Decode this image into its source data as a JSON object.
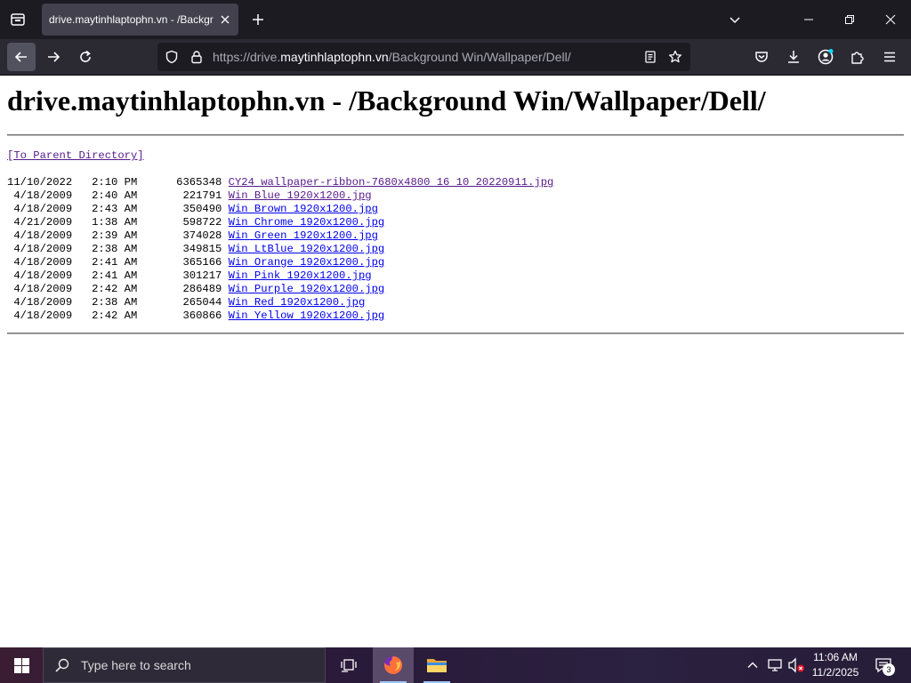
{
  "browser": {
    "tab": {
      "title": "drive.maytinhlaptophn.vn - /Background Win/Wallpaper/Dell/"
    },
    "url": {
      "scheme": "https://drive.",
      "host": "maytinhlaptophn.vn",
      "path": "/Background Win/Wallpaper/Dell/"
    },
    "colors": {
      "tabbar": "#1c1b22",
      "navbar": "#2b2a33",
      "urlbar": "#1c1b22"
    }
  },
  "page": {
    "heading": "drive.maytinhlaptophn.vn - /Background Win/Wallpaper/Dell/",
    "parent_link": "[To Parent Directory]",
    "files": [
      {
        "date": "11/10/2022",
        "time": "2:10 PM",
        "size": "6365348",
        "name": "CY24 wallpaper-ribbon-7680x4800 16 10 20220911.jpg",
        "visited": true
      },
      {
        "date": "4/18/2009",
        "time": "2:40 AM",
        "size": "221791",
        "name": "Win Blue 1920x1200.jpg",
        "visited": true
      },
      {
        "date": "4/18/2009",
        "time": "2:43 AM",
        "size": "350490",
        "name": "Win Brown 1920x1200.jpg",
        "visited": false
      },
      {
        "date": "4/21/2009",
        "time": "1:38 AM",
        "size": "598722",
        "name": "Win Chrome 1920x1200.jpg",
        "visited": false
      },
      {
        "date": "4/18/2009",
        "time": "2:39 AM",
        "size": "374028",
        "name": "Win Green 1920x1200.jpg",
        "visited": false
      },
      {
        "date": "4/18/2009",
        "time": "2:38 AM",
        "size": "349815",
        "name": "Win LtBlue 1920x1200.jpg",
        "visited": false
      },
      {
        "date": "4/18/2009",
        "time": "2:41 AM",
        "size": "365166",
        "name": "Win Orange 1920x1200.jpg",
        "visited": false
      },
      {
        "date": "4/18/2009",
        "time": "2:41 AM",
        "size": "301217",
        "name": "Win Pink 1920x1200.jpg",
        "visited": false
      },
      {
        "date": "4/18/2009",
        "time": "2:42 AM",
        "size": "286489",
        "name": "Win Purple 1920x1200.jpg",
        "visited": false
      },
      {
        "date": "4/18/2009",
        "time": "2:38 AM",
        "size": "265044",
        "name": "Win Red 1920x1200.jpg",
        "visited": false
      },
      {
        "date": "4/18/2009",
        "time": "2:42 AM",
        "size": "360866",
        "name": "Win Yellow 1920x1200.jpg",
        "visited": false
      }
    ],
    "colors": {
      "link": "#0000ee",
      "visited": "#551a8b"
    }
  },
  "taskbar": {
    "search_placeholder": "Type here to search",
    "clock": {
      "time": "11:06 AM",
      "date": "11/2/2025"
    },
    "notification_count": "3"
  }
}
